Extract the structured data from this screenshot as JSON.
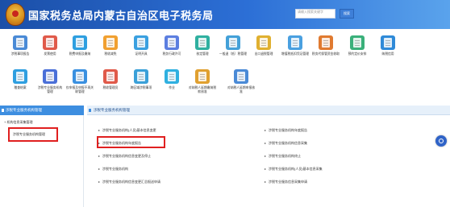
{
  "header": {
    "title": "国家税务总局内蒙古自治区电子税务局",
    "search_placeholder": "请输入搜索关键字",
    "search_label": "搜索"
  },
  "tiles": [
    {
      "name": "涉税事项报告",
      "name2": "",
      "color": "#4a8ad6"
    },
    {
      "name": "发票使用",
      "name2": "",
      "color": "#e05a4a"
    },
    {
      "name": "税费申报及缴纳",
      "name2": "",
      "color": "#2e9fe0"
    },
    {
      "name": "税收减免",
      "name2": "",
      "color": "#f1a030"
    },
    {
      "name": "证明开具",
      "name2": "",
      "color": "#3aa0e0"
    },
    {
      "name": "税务行政许可",
      "name2": "",
      "color": "#5c7ee0"
    },
    {
      "name": "核定管理",
      "name2": "",
      "color": "#2fb0a0"
    },
    {
      "name": "一般退（抵）税管理",
      "name2": "",
      "color": "#43a0d8"
    },
    {
      "name": "出口退税管理",
      "name2": "",
      "color": "#e0b030"
    },
    {
      "name": "增值税抵扣凭证管理",
      "name2": "",
      "color": "#4aa0e0"
    },
    {
      "name": "税务代保管资金收取",
      "name2": "",
      "color": "#e07a30"
    },
    {
      "name": "预约定价安排",
      "name2": "",
      "color": "#3ab07a"
    },
    {
      "name": "纳税信用",
      "name2": "",
      "color": "#2f8ad8"
    },
    {
      "name": "稽查结案",
      "name2": "",
      "color": "#2f9fe0"
    },
    {
      "name": "涉税专业服务机构",
      "name2": "管理",
      "color": "#4a6fd8"
    },
    {
      "name": "仅申报及申报不再关",
      "name2": "联管理",
      "color": "#3a90e0"
    },
    {
      "name": "税收管理员",
      "name2": "",
      "color": "#e05a4a"
    },
    {
      "name": "跨区域涉税事项",
      "name2": "",
      "color": "#3aa0d8"
    },
    {
      "name": "作业",
      "name2": "",
      "color": "#2fb0e0"
    },
    {
      "name": "对纳税人延期缴纳税",
      "name2": "款核准",
      "color": "#e0a030"
    },
    {
      "name": "对纳税人延期申报核",
      "name2": "准",
      "color": "#4a8ad6"
    }
  ],
  "left_panel": {
    "heading": "涉税专业服务机构管理",
    "subheading": "+ 机构信息采集管理",
    "item": "涉税专业服务机构管理"
  },
  "right_panel": {
    "heading": "涉税专业服务机构管理",
    "links_left": [
      "涉税专业服务机构(人员)基本信息变更",
      "涉税专业服务机构年度报告",
      "涉税专业服务机构信息变更及停止",
      "涉税专业服务机构",
      "涉税专业服务机构信息变更汇总报送申请"
    ],
    "links_right": [
      "涉税专业服务机构年度报告",
      "涉税专业服务机构信息采集",
      "涉税专业服务机构终止",
      "涉税专业服务机构(人员)基本信息采集",
      "涉税专业服务信息采集申请"
    ]
  }
}
